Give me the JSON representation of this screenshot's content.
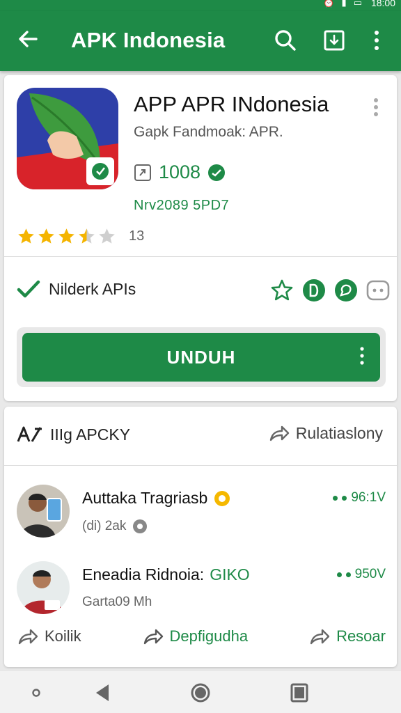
{
  "status_bar": {
    "time": "18:00"
  },
  "app_bar": {
    "title": "APK Indonesia"
  },
  "app": {
    "name": "APP APR INdonesia",
    "developer": "Gapk Fandmoak: APR.",
    "downloads": "1008",
    "version": "Nrv2089 5PD7",
    "rating_value": 3.5,
    "rating_max": 5,
    "rating_count": "13"
  },
  "verification": {
    "label": "Nilderk APIs"
  },
  "install_button": {
    "label": "UNDUH"
  },
  "section": {
    "title": "IIIg APCKY",
    "action_label": "Rulatiaslony",
    "items": [
      {
        "name": "Auttaka Tragriasb",
        "subtitle": "(di) 2ak",
        "meta": "96:1V"
      },
      {
        "name": "Eneadia Ridnoia:",
        "name_suffix": "GIKO",
        "subtitle": "Garta09 Mh",
        "meta": "950V"
      }
    ]
  },
  "actions": [
    {
      "label": "Koilik"
    },
    {
      "label": "Depfigudha"
    },
    {
      "label": "Resoar"
    }
  ],
  "colors": {
    "primary": "#1e8a47",
    "star": "#f4b400"
  }
}
